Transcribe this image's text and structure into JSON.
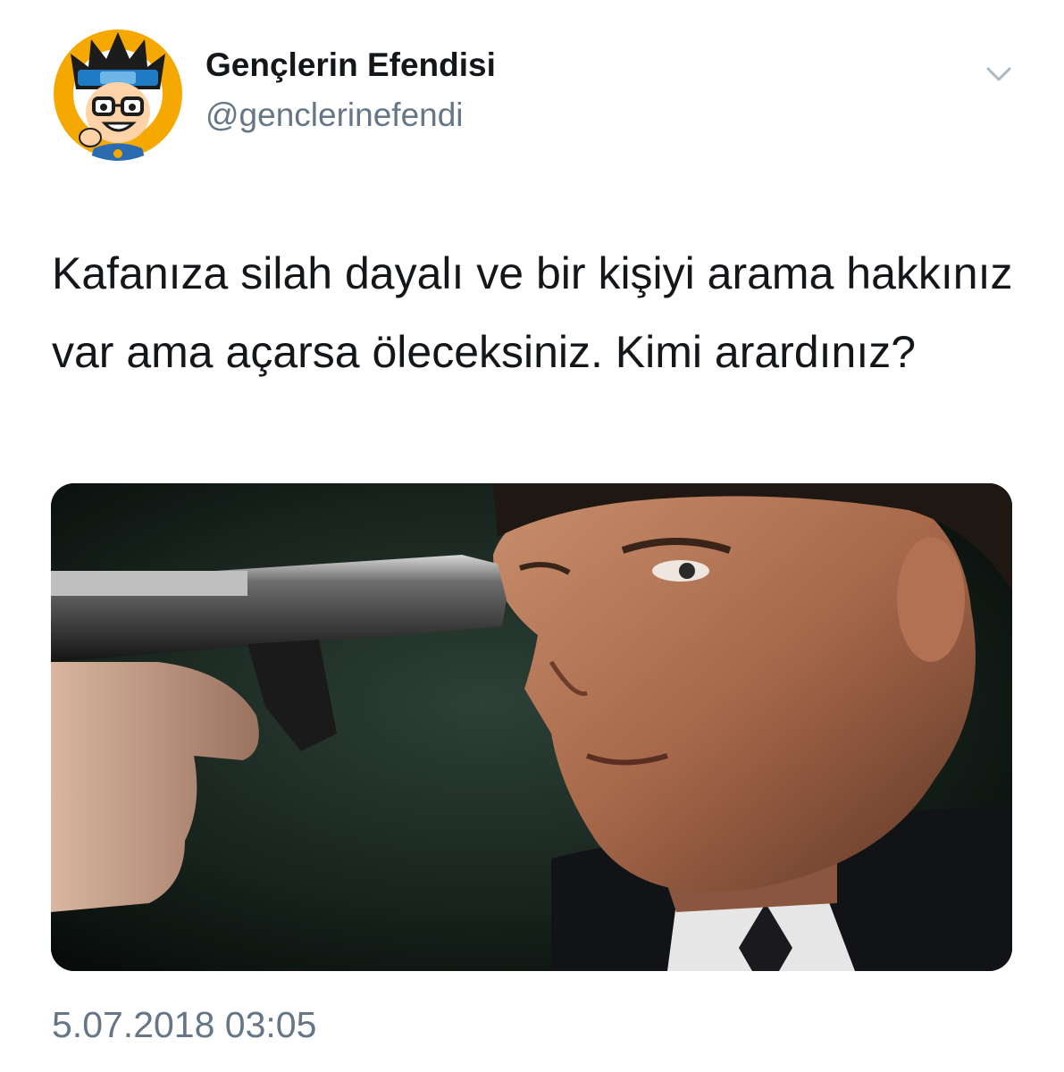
{
  "author": {
    "display_name": "Gençlerin Efendisi",
    "username": "@genclerinefendi",
    "avatar_icon": "cartoon-avatar-icon"
  },
  "menu": {
    "icon": "chevron-down-icon"
  },
  "tweet": {
    "text": "Kafanıza silah dayalı ve bir kişiyi arama hakkınız var ama açarsa öleceksiniz. Kimi arardınız?",
    "timestamp": "5.07.2018 03:05"
  },
  "colors": {
    "text_primary": "#14171a",
    "text_secondary": "#657786",
    "avatar_accent": "#f5a800"
  }
}
